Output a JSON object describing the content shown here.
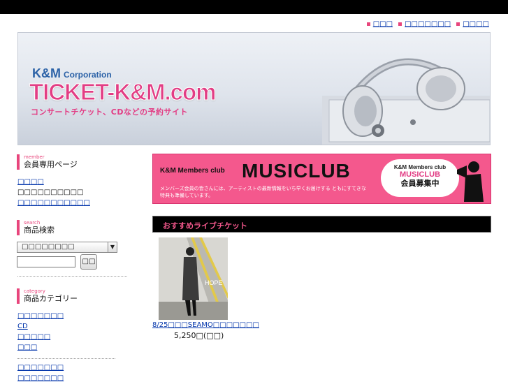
{
  "top_links": [
    {
      "label": "□□□"
    },
    {
      "label": "□□□□□□□"
    },
    {
      "label": "□□□□"
    }
  ],
  "header": {
    "corp": "K&M",
    "corp_suffix": "Corporation",
    "logo": "TICKET-K&M.com",
    "tagline": "コンサートチケット、CDなどの予約サイト"
  },
  "member": {
    "en": "member",
    "title": "会員専用ページ",
    "link1": "□□□□",
    "text": "□□□□□□□□□□",
    "link2": "□□□□□□□□□□□"
  },
  "search": {
    "en": "search",
    "title": "商品検索",
    "select_value": "□□□□□□□□",
    "button_label": "□□"
  },
  "category": {
    "en": "category",
    "title": "商品カテゴリー",
    "items": [
      {
        "label": "□□□□□□□"
      },
      {
        "label": "CD"
      },
      {
        "label": "□□□□□"
      },
      {
        "label": "□□□"
      }
    ],
    "extra_links": [
      {
        "label": "□□□□□□□"
      },
      {
        "label": "□□□□□□□"
      }
    ]
  },
  "banner": {
    "club": "K&M Members club",
    "big": "MUSICLUB",
    "desc": "メンバーズ会員の皆さんには、アーティストの最新情報をいち早くお届けする ともにすてきな特典も準備しています。",
    "pill_line1": "K&M Members club",
    "pill_line2": "MUSICLUB",
    "pill_line3": "会員募集中"
  },
  "recommend": {
    "title": "おすすめライブチケット"
  },
  "product": {
    "name": "8/25□□□SEAMO□□□□□□□",
    "price": "5,250□(□□)",
    "photo_text": "HOPE"
  },
  "colors": {
    "accent": "#e8457c",
    "link": "#0033aa",
    "topbar": "#000000"
  }
}
